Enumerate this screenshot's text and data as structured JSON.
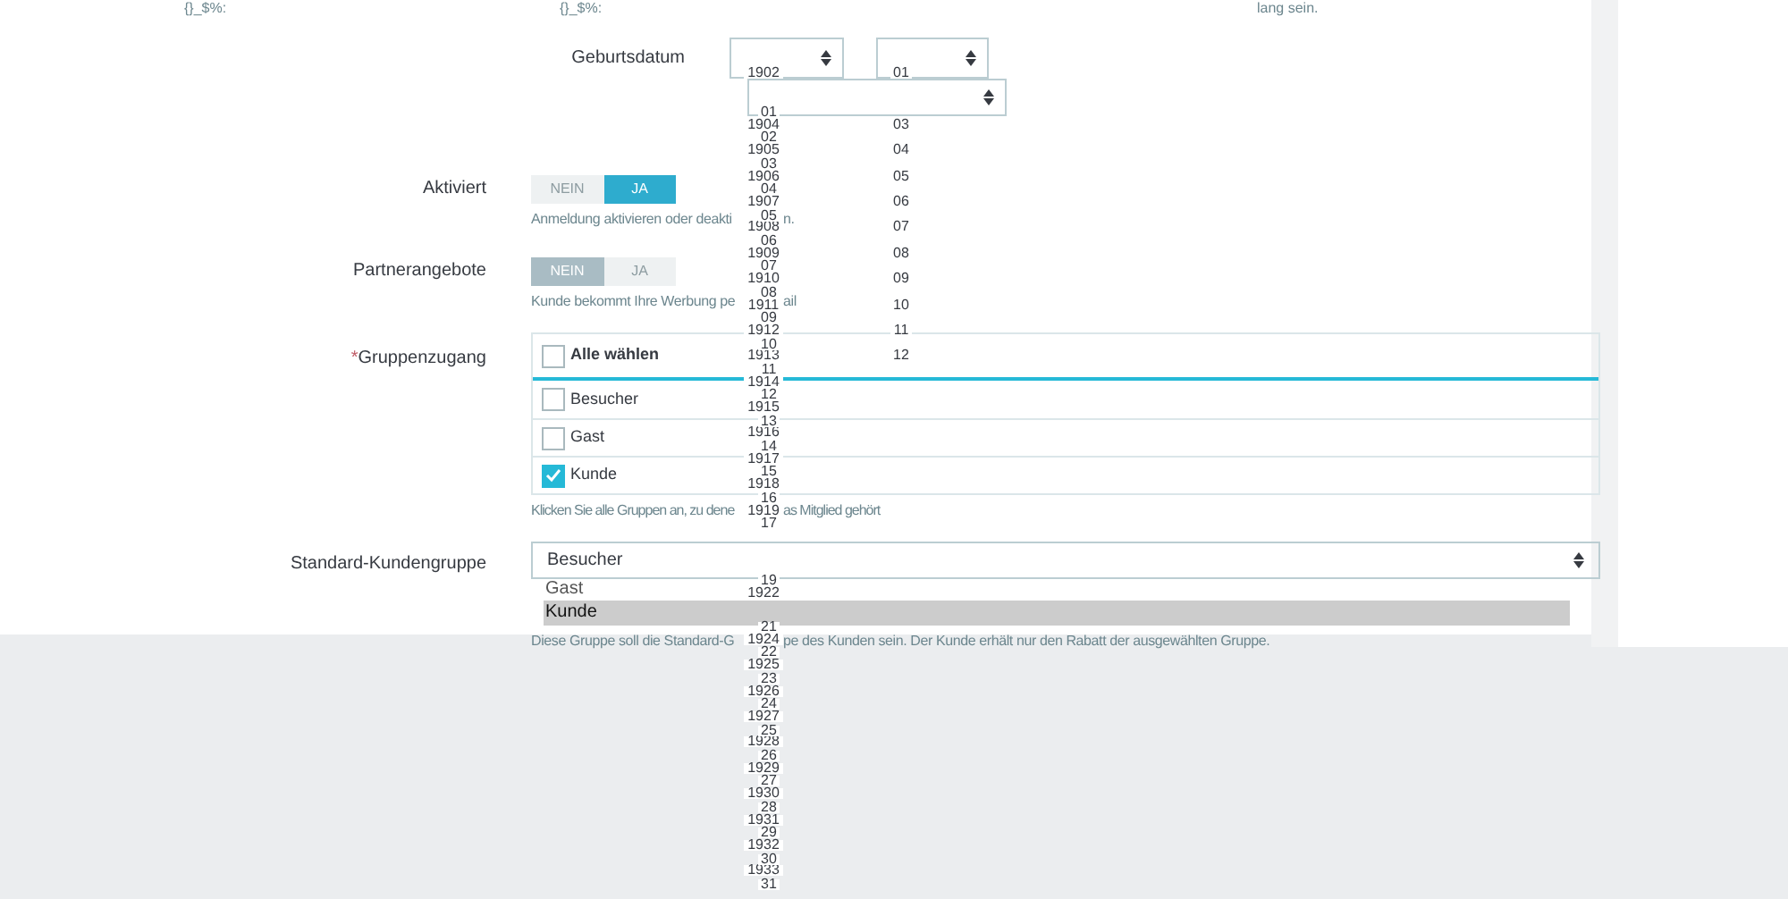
{
  "top_texts": [
    "{}_$%:",
    "{}_$%:",
    "lang sein."
  ],
  "birthdate": {
    "label": "Geburtsdatum",
    "year_options": [
      [
        "1902"
      ],
      [
        "1904",
        "1905",
        "1906",
        "1907",
        "1908",
        "1909",
        "1910",
        "1911",
        "1912",
        "1913",
        "1914",
        "1915",
        "1916",
        "1917",
        "1918",
        "1919"
      ],
      [
        "1922"
      ],
      [
        "1924",
        "1925",
        "1926",
        "1927",
        "1928",
        "1929",
        "1930",
        "1931",
        "1932",
        "1933"
      ]
    ],
    "month_options": [
      [
        "01"
      ],
      [
        "03",
        "04",
        "05",
        "06",
        "07",
        "08",
        "09",
        "10",
        "11",
        "12"
      ]
    ],
    "day_options": [
      [
        "01",
        "02",
        "03",
        "04",
        "05",
        "06",
        "07",
        "08",
        "09",
        "10",
        "11",
        "12",
        "13",
        "14",
        "15",
        "16",
        "17"
      ],
      [
        "19"
      ],
      [
        "21",
        "22",
        "23",
        "24",
        "25",
        "26",
        "27",
        "28",
        "29",
        "30",
        "31"
      ]
    ]
  },
  "activated": {
    "label": "Aktiviert",
    "options": [
      {
        "label": "NEIN",
        "selected": false
      },
      {
        "label": "JA",
        "selected": true
      }
    ],
    "help_parts": [
      "Anmeldung aktivieren oder deakti",
      "n."
    ]
  },
  "partner_offers": {
    "label": "Partnerangebote",
    "options": [
      {
        "label": "NEIN",
        "selected": true
      },
      {
        "label": "JA",
        "selected": false
      }
    ],
    "help_parts": [
      "Kunde bekommt Ihre Werbung pe",
      "ail"
    ]
  },
  "group_access": {
    "required_mark": "*",
    "label": "Gruppenzugang",
    "select_all": {
      "label": "Alle wählen",
      "checked": false
    },
    "groups": [
      {
        "label": "Besucher",
        "checked": false
      },
      {
        "label": "Gast",
        "checked": false
      },
      {
        "label": "Kunde",
        "checked": true
      }
    ],
    "help_parts": [
      "Klicken Sie alle Gruppen an, zu dene",
      "as Mitglied gehört"
    ]
  },
  "default_group": {
    "label": "Standard-Kundengruppe",
    "value": "Besucher",
    "options": [
      {
        "label": "Gast",
        "selected": false
      },
      {
        "label": "Kunde",
        "selected": true
      }
    ],
    "help_parts": [
      "Diese Gruppe soll die Standard-G",
      "pe des Kunden sein. Der Kunde erhält nur den Rabatt der ausgewählten Gruppe."
    ]
  }
}
